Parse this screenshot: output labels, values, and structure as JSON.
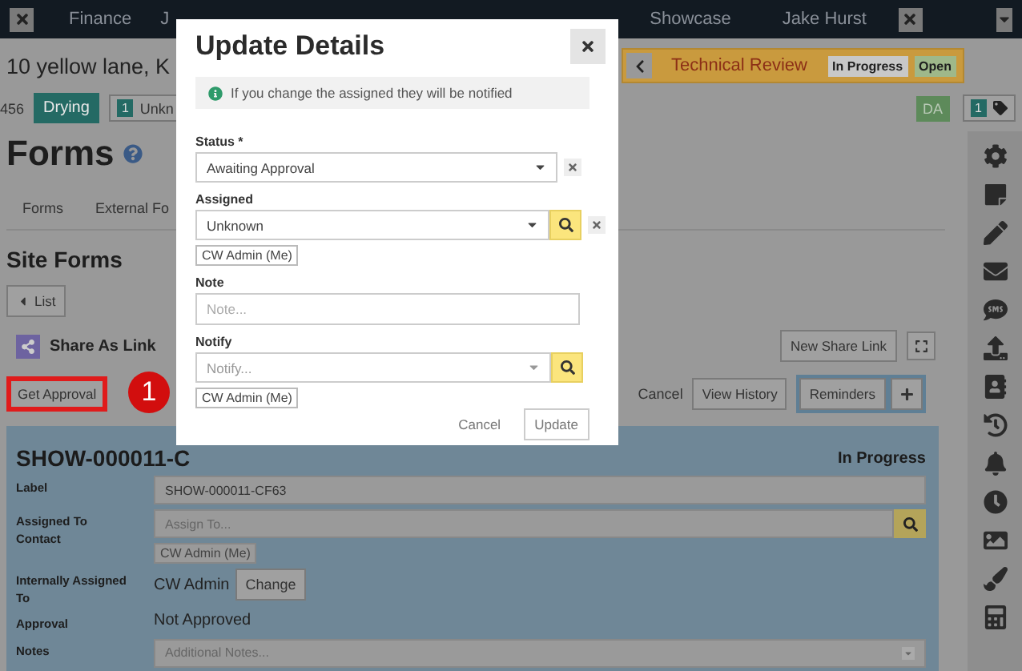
{
  "top_nav": {
    "items": [
      "Finance",
      "J",
      "Showcase",
      "Jake Hurst"
    ]
  },
  "job": {
    "address": "10 yellow lane, K",
    "number": "456",
    "status_badge": "Drying",
    "count_badge": "1",
    "count_label": "Unkn"
  },
  "stage": {
    "name": "Technical Review",
    "tags": [
      {
        "label": "In Progress",
        "kind": "progress"
      },
      {
        "label": "Open",
        "kind": "open"
      }
    ]
  },
  "user_badge": "DA",
  "tag_count": "1",
  "page": {
    "title": "Forms",
    "tabs": [
      "Forms",
      "External Fo"
    ]
  },
  "site_forms": {
    "title": "Site Forms",
    "back_button": "List",
    "share_label": "Share As Link",
    "new_share_link": "New Share Link",
    "get_approval": "Get Approval",
    "annotation": "1",
    "actions": [
      {
        "label": "Cancel",
        "kind": "link"
      },
      {
        "label": "View History",
        "kind": "button"
      },
      {
        "label": "Reminders",
        "kind": "group"
      }
    ]
  },
  "form": {
    "title": "SHOW-000011-C",
    "status": "In Progress",
    "fields": [
      {
        "kind": "input",
        "label": "Label",
        "value": "SHOW-000011-CF63"
      },
      {
        "kind": "lookup",
        "label": "Assigned To Contact",
        "placeholder": "Assign To...",
        "chip": "CW Admin (Me)"
      },
      {
        "kind": "change",
        "label": "Internally Assigned To",
        "value": "CW Admin",
        "button": "Change"
      },
      {
        "kind": "text",
        "label": "Approval",
        "value": "Not Approved"
      },
      {
        "kind": "select",
        "label": "Notes",
        "placeholder": "Additional Notes..."
      }
    ]
  },
  "modal": {
    "title": "Update Details",
    "info": "If you change the assigned they will be notified",
    "fields": [
      {
        "kind": "select",
        "label": "Status *",
        "value": "Awaiting Approval",
        "clearable": true
      },
      {
        "kind": "lookup",
        "label": "Assigned",
        "value": "Unknown",
        "clearable": true,
        "chip": "CW Admin (Me)"
      },
      {
        "kind": "textarea",
        "label": "Note",
        "placeholder": "Note..."
      },
      {
        "kind": "lookup",
        "label": "Notify",
        "placeholder": "Notify...",
        "clearable": false,
        "chip": "CW Admin (Me)"
      }
    ],
    "buttons": [
      {
        "label": "Cancel",
        "kind": "link"
      },
      {
        "label": "Update",
        "kind": "outline"
      }
    ]
  }
}
